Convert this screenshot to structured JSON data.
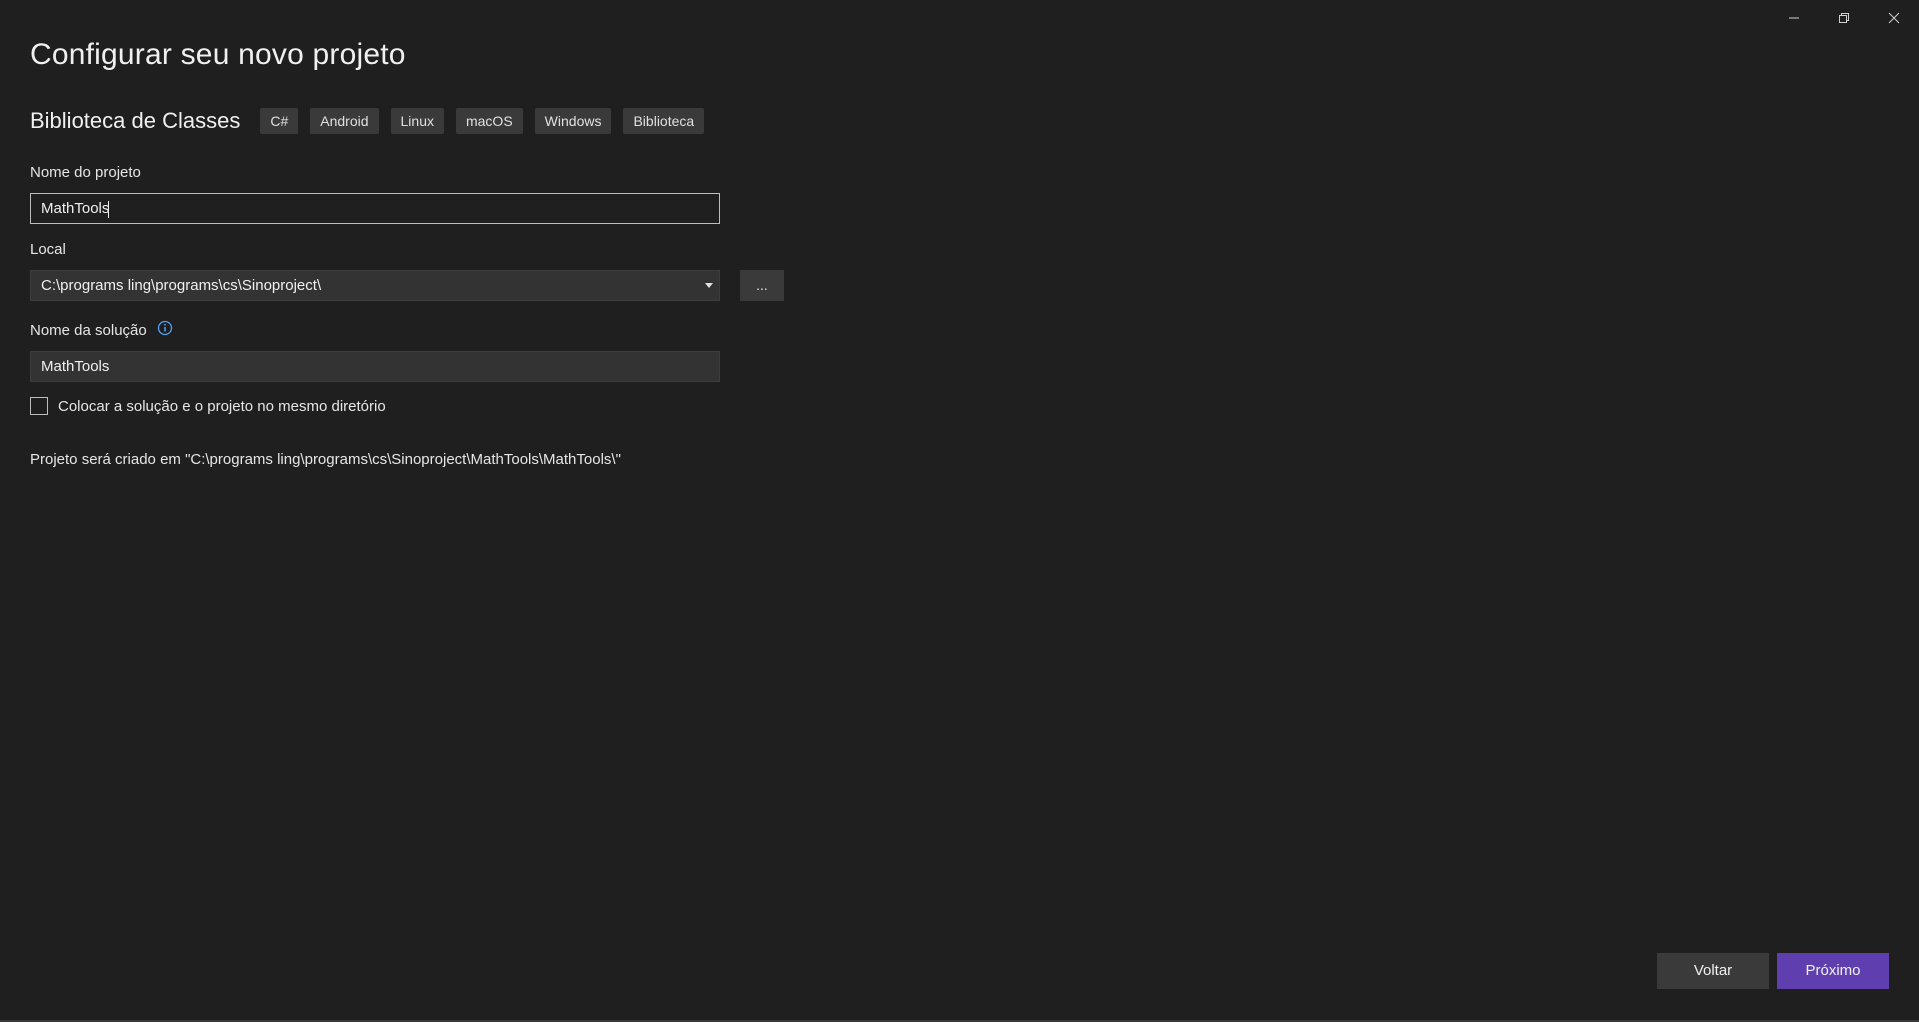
{
  "window": {
    "controls": {
      "minimize": "minimize-icon",
      "restore": "restore-icon",
      "close": "close-icon"
    }
  },
  "page_title": "Configurar seu novo projeto",
  "template": {
    "name": "Biblioteca de Classes",
    "tags": [
      "C#",
      "Android",
      "Linux",
      "macOS",
      "Windows",
      "Biblioteca"
    ]
  },
  "project_name": {
    "label": "Nome do projeto",
    "value": "MathTools"
  },
  "location": {
    "label": "Local",
    "value": "C:\\programs ling\\programs\\cs\\Sinoproject\\",
    "browse_label": "..."
  },
  "solution_name": {
    "label": "Nome da solução",
    "value": "MathTools",
    "info_icon": "info-icon"
  },
  "same_directory": {
    "label": "Colocar a solução e o projeto no mesmo diretório",
    "checked": false
  },
  "path_info": "Projeto será criado em \"C:\\programs ling\\programs\\cs\\Sinoproject\\MathTools\\MathTools\\\"",
  "footer": {
    "back_label": "Voltar",
    "next_label": "Próximo"
  },
  "colors": {
    "background": "#1f1f1f",
    "accent": "#5f3fb0",
    "info": "#4fa3f7"
  }
}
